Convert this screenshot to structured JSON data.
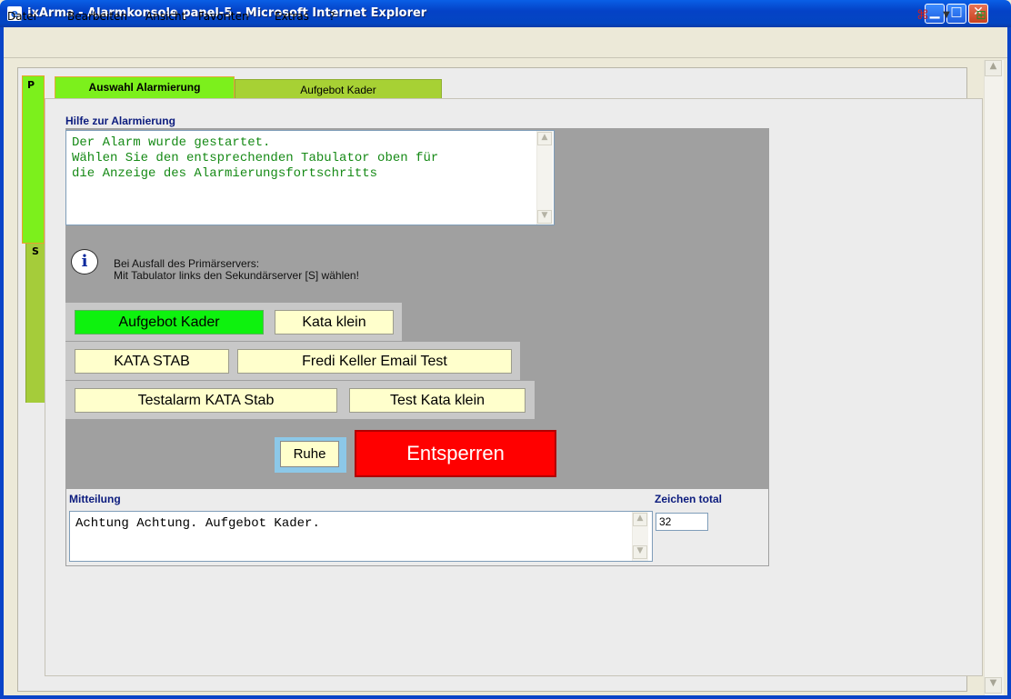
{
  "window": {
    "title": "ixArma - Alarmkonsole panel-5 - Microsoft Internet Explorer",
    "minimize": "▁",
    "maximize": "□",
    "close": "✕"
  },
  "menu": {
    "items": [
      "Datei",
      "Bearbeiten",
      "Ansicht",
      "Favoriten",
      "Extras",
      "?"
    ]
  },
  "server_tabs": {
    "primary": "P",
    "secondary": "S"
  },
  "tabs": [
    {
      "label": "Auswahl Alarmierung",
      "active": true
    },
    {
      "label": "Aufgebot Kader",
      "active": false
    }
  ],
  "help": {
    "title": "Hilfe zur Alarmierung",
    "lines": [
      "Der Alarm wurde gestartet.",
      "Wählen Sie den entsprechenden Tabulator oben für",
      "die Anzeige des Alarmierungsfortschritts"
    ]
  },
  "info": {
    "icon": "i",
    "line1": "Bei Ausfall des Primärservers:",
    "line2": "Mit Tabulator links den Sekundärserver [S] wählen!"
  },
  "alarm_buttons": [
    [
      "Aufgebot Kader",
      "Kata klein"
    ],
    [
      "KATA STAB",
      "Fredi Keller Email Test"
    ],
    [
      "Testalarm KATA Stab",
      "Test Kata klein"
    ]
  ],
  "controls": {
    "ruhe": "Ruhe",
    "unlock": "Entsperren"
  },
  "message": {
    "title": "Mitteilung",
    "text": "Achtung Achtung. Aufgebot Kader.",
    "count_label": "Zeichen total",
    "count": "32"
  },
  "colors": {
    "active_alarm": "#0ef20e",
    "unlock_button": "#ff0000",
    "help_text": "#168a16",
    "title_blue": "#0c1c7e"
  }
}
